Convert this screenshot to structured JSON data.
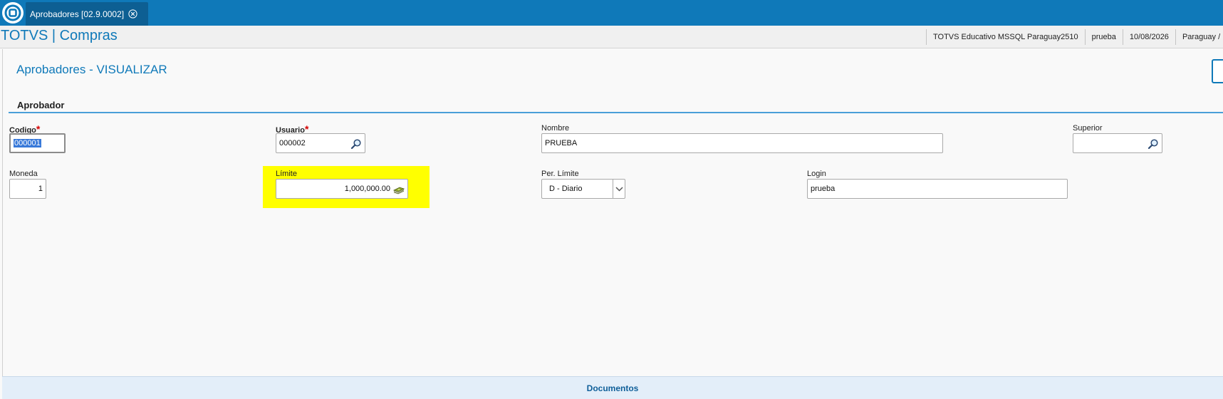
{
  "tab": {
    "label": "Aprobadores [02.9.0002]"
  },
  "app": {
    "title": "TOTVS | Compras"
  },
  "status": [
    "TOTVS Educativo MSSQL Paraguay2510",
    "prueba",
    "10/08/2026",
    "Paraguay /"
  ],
  "page": {
    "title": "Aprobadores - VISUALIZAR"
  },
  "section": {
    "title": "Aprobador"
  },
  "fields": {
    "codigo": {
      "label": "Codigo",
      "value": "000001"
    },
    "usuario": {
      "label": "Usuario",
      "value": "000002"
    },
    "nombre": {
      "label": "Nombre",
      "value": "PRUEBA"
    },
    "superior": {
      "label": "Superior",
      "value": ""
    },
    "moneda": {
      "label": "Moneda",
      "value": "1"
    },
    "limite": {
      "label": "Límite",
      "value": "1,000,000.00"
    },
    "per_limite": {
      "label": "Per. Límite",
      "value": "D - Diario"
    },
    "login": {
      "label": "Login",
      "value": "prueba"
    }
  },
  "required_mark": "*",
  "footer": {
    "label": "Documentos"
  },
  "colors": {
    "brand": "#0f79b9",
    "highlight": "#ffff00",
    "required": "#d40000"
  }
}
